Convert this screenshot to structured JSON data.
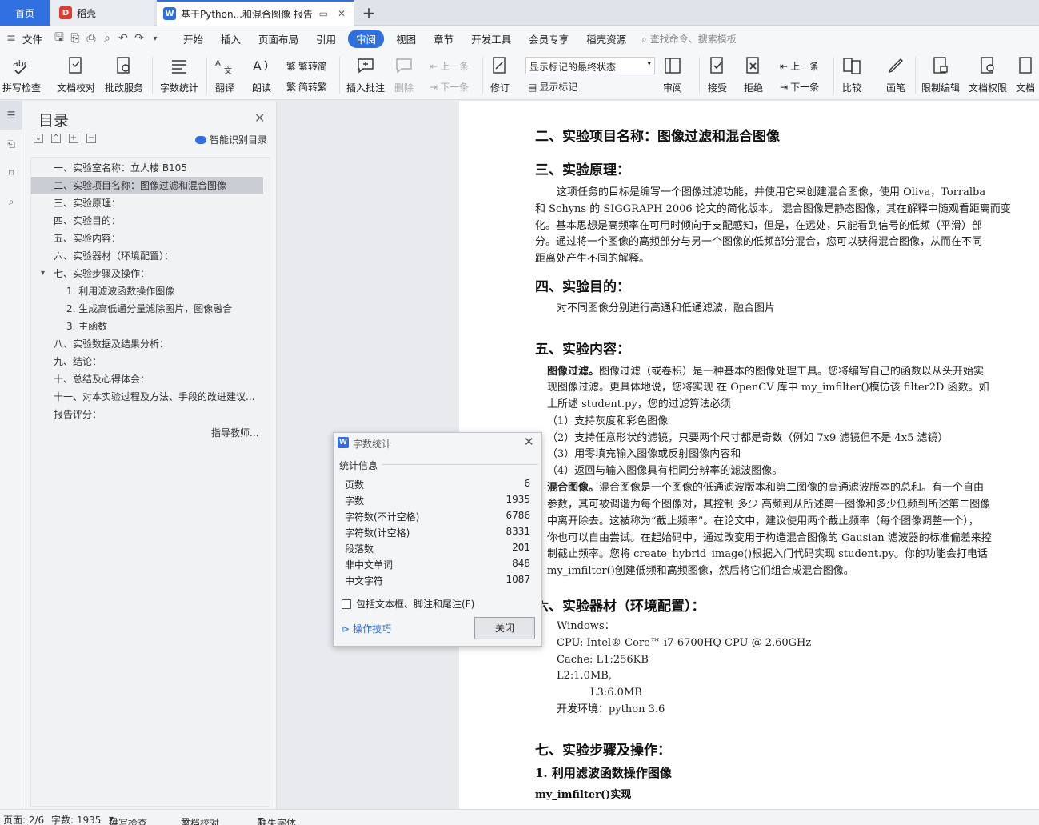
{
  "tabs": {
    "home": "首页",
    "daoke": "稻壳",
    "doc": "基于Python...和混合图像 报告"
  },
  "menu": {
    "file": "文件",
    "items": [
      "开始",
      "插入",
      "页面布局",
      "引用",
      "审阅",
      "视图",
      "章节",
      "开发工具",
      "会员专享",
      "稻壳资源"
    ],
    "search": "查找命令、搜索模板"
  },
  "ribbon": {
    "spell": "拼写检查",
    "proof": "文档校对",
    "review_service": "批改服务",
    "word_count": "字数统计",
    "translate": "翻译",
    "read": "朗读",
    "to_trad": "繁转简",
    "to_simp": "简转繁",
    "insert_comment": "插入批注",
    "delete": "删除",
    "prev_comment": "上一条",
    "next_comment": "下一条",
    "track": "修订",
    "markup_state": "显示标记的最终状态",
    "show_markup": "显示标记",
    "review": "审阅",
    "accept": "接受",
    "reject": "拒绝",
    "prev_change": "上一条",
    "next_change": "下一条",
    "compare": "比较",
    "pen": "画笔",
    "restrict": "限制编辑",
    "doc_rights": "文档权限",
    "doc_more": "文档"
  },
  "toc": {
    "title": "目录",
    "smart": "智能识别目录",
    "items": [
      "一、实验室名称：立人楼 B105",
      "二、实验项目名称：图像过滤和混合图像",
      "三、实验原理：",
      "四、实验目的：",
      "五、实验内容：",
      "六、实验器材（环境配置）：",
      "七、实验步骤及操作：",
      "1. 利用滤波函数操作图像",
      "2. 生成高低通分量滤除图片，图像融合",
      "3. 主函数",
      "八、实验数据及结果分析：",
      "九、结论：",
      "十、总结及心得体会：",
      "十一、对本实验过程及方法、手段的改进建议...",
      "报告评分："
    ],
    "teacher": "指导教师..."
  },
  "doc": {
    "h2": "二、实验项目名称：图像过滤和混合图像",
    "h3": "三、实验原理：",
    "p3_1": "这项任务的目标是编写一个图像过滤功能，并使用它来创建混合图像，使用 Oliva，Torralba",
    "p3_2": "和 Schyns 的 SIGGRAPH 2006 论文的简化版本。 混合图像是静态图像，其在解释中随观看距离而变",
    "p3_3": "化。基本思想是高频率在可用时倾向于支配感知，但是，在远处，只能看到信号的低频（平滑）部",
    "p3_4": "分。通过将一个图像的高频部分与另一个图像的低频部分混合，您可以获得混合图像，从而在不同",
    "p3_5": "距离处产生不同的解释。",
    "h4": "四、实验目的：",
    "p4": "对不同图像分别进行高通和低通滤波，融合图片",
    "h5": "五、实验内容：",
    "p5_1a": "图像过滤。",
    "p5_1b": "图像过滤（或卷积）是一种基本的图像处理工具。您将编写自己的函数以从头开始实",
    "p5_2": "现图像过滤。更具体地说，您将实现 在 OpenCV 库中 my_imfilter()模仿该 filter2D 函数。如",
    "p5_3": "上所述 student.py，您的过滤算法必须",
    "p5_4": "（1）支持灰度和彩色图像",
    "p5_5": "（2）支持任意形状的滤镜，只要两个尺寸都是奇数（例如 7x9 滤镜但不是 4x5 滤镜）",
    "p5_6": "（3）用零填充输入图像或反射图像内容和",
    "p5_7": "（4）返回与输入图像具有相同分辨率的滤波图像。",
    "p5_8a": "混合图像。",
    "p5_8b": "混合图像是一个图像的低通滤波版本和第二图像的高通滤波版本的总和。有一个自由",
    "p5_9": "参数，其可被调谐为每个图像对，其控制 多少 高频到从所述第一图像和多少低频到所述第二图像",
    "p5_10": "中离开除去。这被称为“截止频率”。在论文中，建议使用两个截止频率（每个图像调整一个），",
    "p5_11": "你也可以自由尝试。在起始码中，通过改变用于构造混合图像的 Gausian 滤波器的标准偏差来控",
    "p5_12": "制截止频率。您将 create_hybrid_image()根据入门代码实现 student.py。你的功能会打电话",
    "p5_13": "my_imfilter()创建低频和高频图像，然后将它们组合成混合图像。",
    "h6": "六、实验器材（环境配置）：",
    "p6_1": "Windows：",
    "p6_2": "CPU: Intel® Core™ i7-6700HQ CPU @ 2.60GHz",
    "p6_3": "Cache: L1:256KB",
    "p6_4": "L2:1.0MB,",
    "p6_5": "L3:6.0MB",
    "p6_6": "开发环境：python 3.6",
    "h7": "七、实验步骤及操作：",
    "h7_1": "1. 利用滤波函数操作图像",
    "h7_2": "my_imfilter()实现"
  },
  "dialog": {
    "title": "字数统计",
    "section": "统计信息",
    "rows": [
      {
        "k": "页数",
        "v": "6"
      },
      {
        "k": "字数",
        "v": "1935"
      },
      {
        "k": "字符数(不计空格)",
        "v": "6786"
      },
      {
        "k": "字符数(计空格)",
        "v": "8331"
      },
      {
        "k": "段落数",
        "v": "201"
      },
      {
        "k": "非中文单词",
        "v": "848"
      },
      {
        "k": "中文字符",
        "v": "1087"
      }
    ],
    "checkbox": "包括文本框、脚注和尾注(F)",
    "tips": "操作技巧",
    "close": "关闭"
  },
  "status": {
    "page": "页面: 2/6",
    "words": "字数: 1935",
    "spell": "拼写检查",
    "proof": "文档校对",
    "font": "缺失字体"
  },
  "colors": {
    "accent": "#2f6fe0"
  }
}
